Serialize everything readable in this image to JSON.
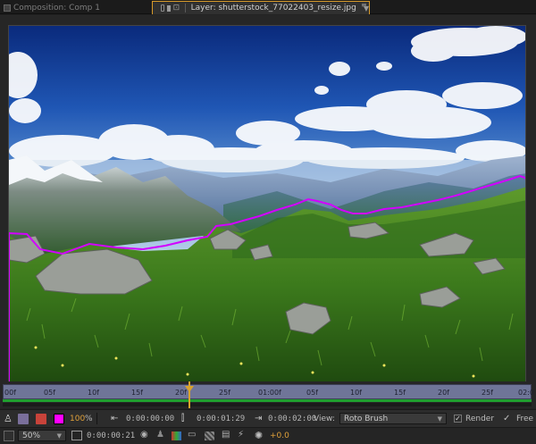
{
  "tabs": {
    "composition_tab": "Composition: Comp 1",
    "layer_tab": "Layer: shutterstock_77022403_resize.jpg"
  },
  "ruler": {
    "ticks": [
      "00f",
      "05f",
      "10f",
      "15f",
      "20f",
      "25f",
      "01:00f",
      "05f",
      "10f",
      "15f",
      "20f",
      "25f",
      "02:0"
    ]
  },
  "controls": {
    "zoom_percent": "100",
    "percent_sign": "%",
    "in_time": "0:00:00:00",
    "current_time": "0:00:01:29",
    "duration": "0:00:02:00",
    "view_label": "View:",
    "view_value": "Roto Brush",
    "render_label": "Render",
    "freeze_label": "Free",
    "magnification": "50%",
    "timecode": "0:00:00:21",
    "exposure": "+0.0"
  },
  "colors": {
    "matte_outline": "#d200ff",
    "accent": "#d89a2a",
    "ruler": "#6f7598"
  },
  "icons": [
    "lock-icon",
    "layer-icon",
    "close-icon",
    "menu-arrow-icon",
    "figure-icon",
    "alpha-icon",
    "alpha-boundary-icon",
    "camera-icon",
    "grid-icon",
    "fast-preview-icon",
    "exposure-icon"
  ]
}
